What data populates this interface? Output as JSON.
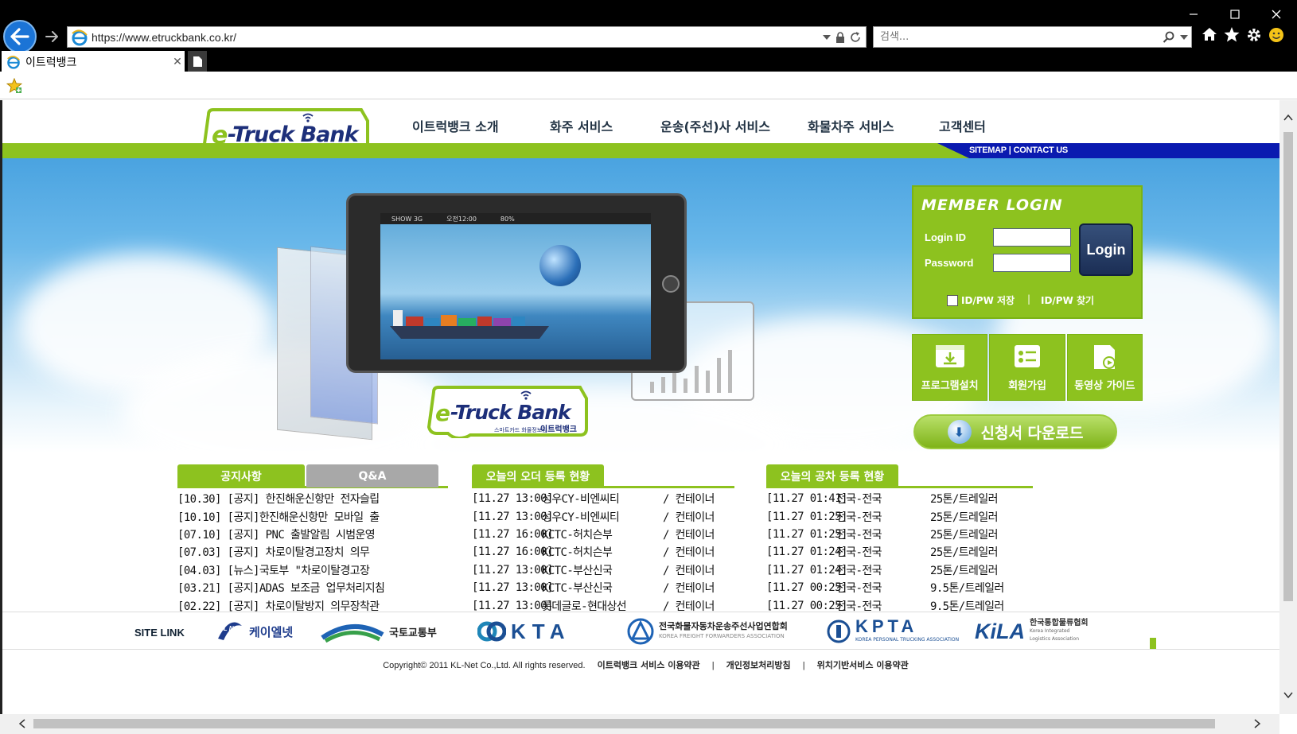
{
  "browser": {
    "url": "https://www.etruckbank.co.kr/",
    "search_placeholder": "검색...",
    "tab_title": "이트럭뱅크"
  },
  "site": {
    "logo_text": "e-Truck Bank",
    "logo_sub": "스마트카드 화물정보망 이트럭뱅크",
    "nav": [
      "이트럭뱅크 소개",
      "화주 서비스",
      "운송(주선)사 서비스",
      "화물차주 서비스",
      "고객센터"
    ],
    "util": [
      "SITEMAP",
      "CONTACT US"
    ]
  },
  "hero": {
    "tablet_status": [
      "SHOW 3G",
      "오전12:00",
      "80%"
    ]
  },
  "login": {
    "title": "MEMBER LOGIN",
    "id_label": "Login ID",
    "pw_label": "Password",
    "button": "Login",
    "save": "ID/PW 저장",
    "separator": "|",
    "find": "ID/PW 찾기"
  },
  "quick": [
    "프로그램설치",
    "회원가입",
    "동영상 가이드"
  ],
  "download": "신청서 다운로드",
  "boards": {
    "notice": {
      "tab_active": "공지사항",
      "tab_inactive": "Q&A",
      "rows": [
        "[10.30] [공지] 한진해운신항만 전자슬립",
        "[10.10] [공지]한진해운신항만 모바일 출",
        "[07.10] [공지] PNC 출발알림 시범운영",
        "[07.03] [공지] 차로이탈경고장치 의무",
        "[04.03] [뉴스]국토부 \"차로이탈경고장",
        "[03.21] [공지]ADAS 보조금 업무처리지침",
        "[02.22] [공지] 차로이탈방지 의무장착관"
      ]
    },
    "orders": {
      "tab": "오늘의 오더 등록 현황",
      "rows": [
        [
          "[11.27 13:00]",
          "성우CY-비엔씨티",
          "/ 컨테이너"
        ],
        [
          "[11.27 13:00]",
          "성우CY-비엔씨티",
          "/ 컨테이너"
        ],
        [
          "[11.27 16:00]",
          "KCTC-허치슨부",
          "/ 컨테이너"
        ],
        [
          "[11.27 16:00]",
          "KCTC-허치슨부",
          "/ 컨테이너"
        ],
        [
          "[11.27 13:00]",
          "KCTC-부산신국",
          "/ 컨테이너"
        ],
        [
          "[11.27 13:00]",
          "KCTC-부산신국",
          "/ 컨테이너"
        ],
        [
          "[11.27 13:00]",
          "롯데글로-현대상선",
          "/ 컨테이너"
        ]
      ]
    },
    "trucks": {
      "tab": "오늘의 공차 등록 현황",
      "rows": [
        [
          "[11.27 01:41]",
          "전국-전국",
          "25톤/트레일러"
        ],
        [
          "[11.27 01:25]",
          "전국-전국",
          "25톤/트레일러"
        ],
        [
          "[11.27 01:25]",
          "전국-전국",
          "25톤/트레일러"
        ],
        [
          "[11.27 01:24]",
          "전국-전국",
          "25톤/트레일러"
        ],
        [
          "[11.27 01:24]",
          "전국-전국",
          "25톤/트레일러"
        ],
        [
          "[11.27 00:25]",
          "전국-전국",
          "9.5톤/트레일러"
        ],
        [
          "[11.27 00:25]",
          "전국-전국",
          "9.5톤/트레일러"
        ]
      ]
    }
  },
  "footer": {
    "site_link": "SITE LINK",
    "partners": {
      "klnet": "케이엘넷",
      "klnet_badge": "KL Net",
      "molit": "국토교통부",
      "kta": "KTA",
      "kffa": "전국화물자동차운송주선사업연합회",
      "kffa_en": "KOREA FREIGHT FORWARDERS ASSOCIATION",
      "kpta": "KPTA",
      "kpta_en": "KOREA PERSONAL TRUCKING ASSOCIATION",
      "kila": "KiLA",
      "kila_ko": "한국통합물류협회",
      "kila_en": "Korea Integrated Logistics Association"
    },
    "copyright": "Copyright© 2011 KL-Net Co.,Ltd. All rights reserved.",
    "links": [
      "이트럭뱅크 서비스 이용약관",
      "개인정보처리방침",
      "위치기반서비스 이용약관"
    ],
    "separator": "|"
  },
  "colors": {
    "brand_green": "#8dc21f",
    "brand_blue": "#0a1ab0",
    "login_button": "#1b2e55"
  }
}
